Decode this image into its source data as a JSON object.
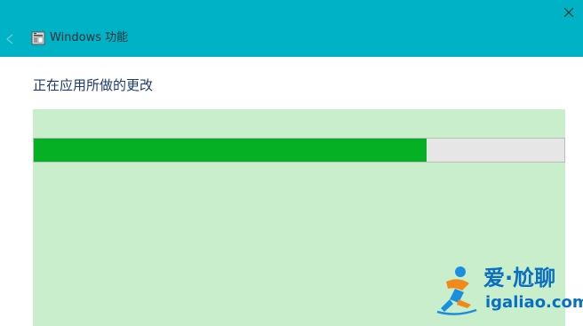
{
  "window": {
    "title": "Windows 功能",
    "title_bar_color": "#00b2c5"
  },
  "content": {
    "heading": "正在应用所做的更改",
    "panel_color": "#c8eecb"
  },
  "progress": {
    "fraction": 0.74,
    "fill_color": "#06b025",
    "track_color": "#e6e6e6"
  },
  "watermark": {
    "name": "爱·尬聊",
    "url": "igaliao.com"
  },
  "icons": {
    "back": "back-arrow-icon",
    "app": "windows-features-icon",
    "close": "close-icon"
  }
}
